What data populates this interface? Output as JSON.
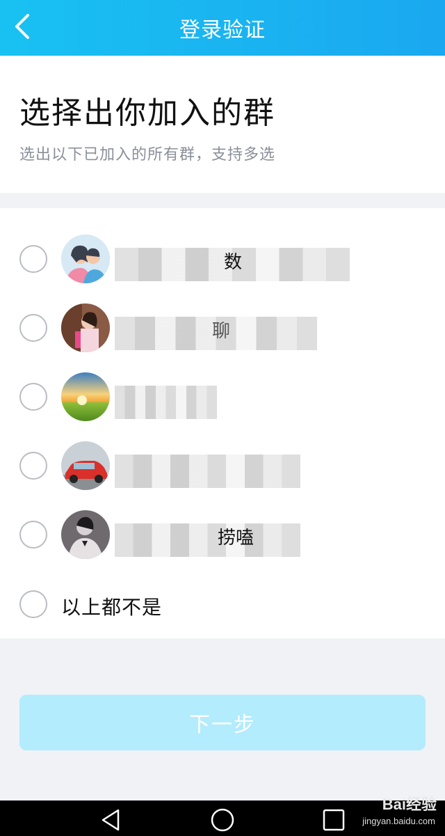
{
  "header": {
    "title": "登录验证",
    "back_icon": "chevron-left-icon"
  },
  "intro": {
    "title": "选择出你加入的群",
    "subtitle": "选出以下已加入的所有群，支持多选"
  },
  "groups": [
    {
      "visible_name_fragment": "数",
      "avatar": "couple-illustration"
    },
    {
      "visible_name_fragment": "聊",
      "avatar": "girl-photo"
    },
    {
      "visible_name_fragment": "",
      "avatar": "sunset-landscape"
    },
    {
      "visible_name_fragment": "",
      "avatar": "red-car"
    },
    {
      "visible_name_fragment": "捞嗑",
      "avatar": "dark-photo"
    }
  ],
  "none_option": {
    "label": "以上都不是"
  },
  "next_button": {
    "label": "下一步"
  },
  "nav": {
    "back": "triangle-back-icon",
    "home": "circle-home-icon",
    "recent": "square-recent-icon"
  },
  "watermark": {
    "brand": "Bai经验",
    "url": "jingyan.baidu.com"
  },
  "colors": {
    "header_start": "#19c1f2",
    "header_end": "#1aa8f0",
    "button_disabled": "#b3ecfc"
  }
}
